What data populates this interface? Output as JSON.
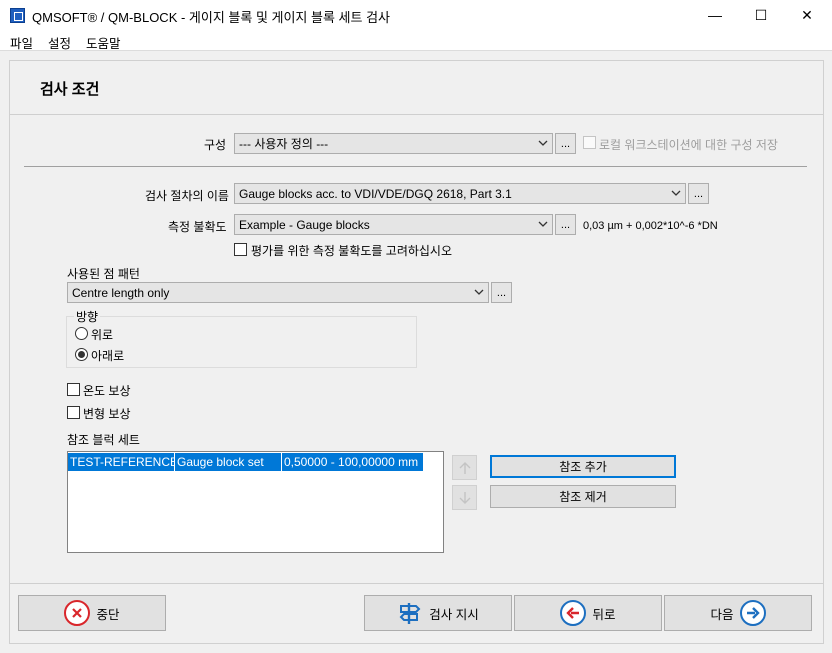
{
  "window": {
    "title": "QMSOFT® / QM-BLOCK - 게이지 블록 및 게이지 블록 세트 검사",
    "minimize": "—",
    "maximize": "☐",
    "close": "✕"
  },
  "menu": [
    "파일",
    "설정",
    "도움말"
  ],
  "page": {
    "title": "검사 조건"
  },
  "config": {
    "label": "구성",
    "value": "--- 사용자 정의 ---",
    "dots": "...",
    "save_local_label": "로컬 워크스테이션에 대한 구성 저장",
    "save_local_checked": false
  },
  "procedure": {
    "label": "검사 절차의 이름",
    "value": "Gauge blocks acc. to VDI/VDE/DGQ 2618, Part 3.1",
    "dots": "..."
  },
  "uncertainty": {
    "label": "측정 불확도",
    "value": "Example - Gauge blocks",
    "dots": "...",
    "formula": "0,03 µm + 0,002*10^-6 *DN",
    "consider_label": "평가를 위한 측정 불확도를 고려하십시오",
    "consider_checked": false
  },
  "pattern": {
    "label": "사용된 점 패턴",
    "value": "Centre length only",
    "dots": "..."
  },
  "direction": {
    "group_label": "방향",
    "options": [
      {
        "label": "위로",
        "selected": false
      },
      {
        "label": "아래로",
        "selected": true
      }
    ]
  },
  "compensation": {
    "temperature_label": "온도 보상",
    "temperature_checked": false,
    "deformation_label": "변형 보상",
    "deformation_checked": false
  },
  "reference": {
    "label": "참조 블럭 세트",
    "rows": [
      {
        "name": "TEST-REFERENCE-BL",
        "type": "Gauge block set",
        "range": "0,50000 - 100,00000 mm"
      }
    ],
    "add_label": "참조 추가",
    "remove_label": "참조 제거"
  },
  "footer": {
    "abort_label": "중단",
    "inspect_label": "검사 지시",
    "back_label": "뒤로",
    "next_label": "다음"
  },
  "colors": {
    "accent": "#0078d7",
    "icon_blue": "#1d6fc0",
    "icon_red": "#d9262b"
  }
}
